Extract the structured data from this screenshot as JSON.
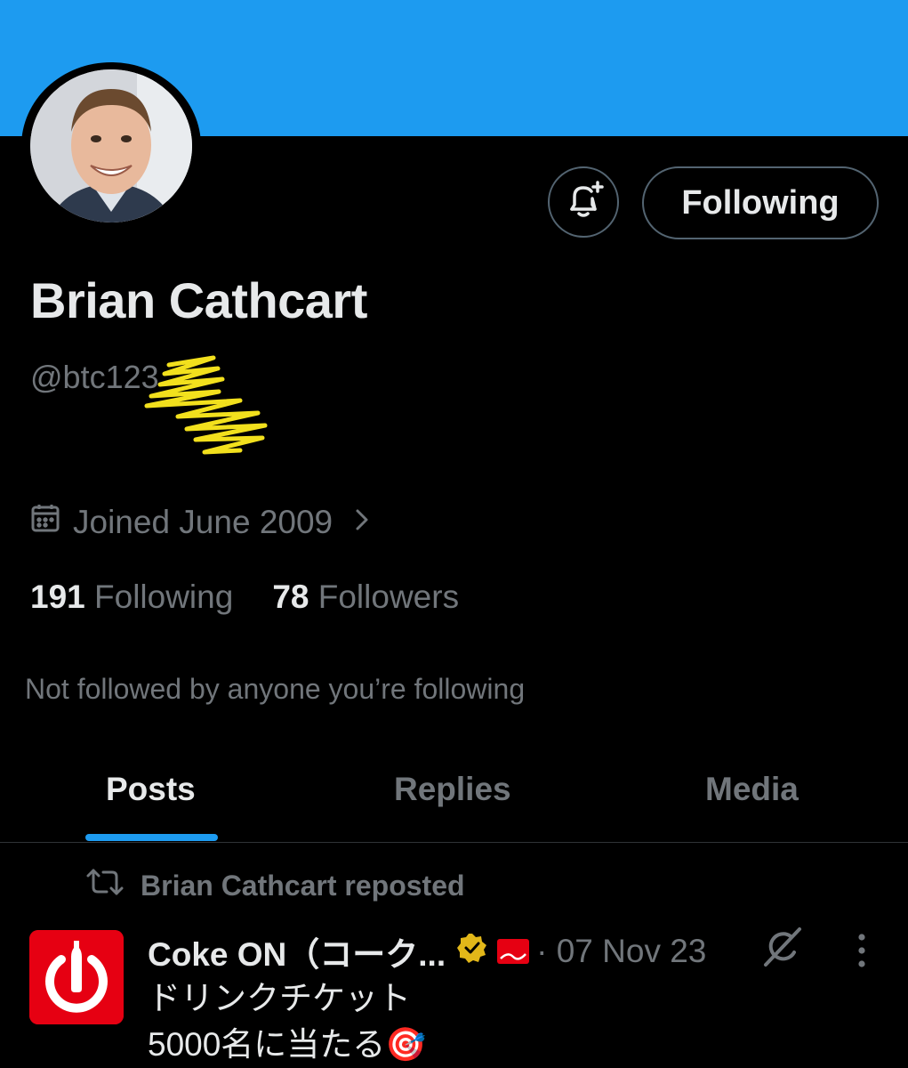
{
  "colors": {
    "accent": "#1d9bf0",
    "background": "#000000",
    "secondary_text": "#71767b",
    "primary_text": "#e7e9ea",
    "brand_red": "#e60012"
  },
  "profile": {
    "name": "Brian Cathcart",
    "handle": "@btc123",
    "joined": "Joined June 2009",
    "following_count": "191",
    "following_label": "Following",
    "followers_count": "78",
    "followers_label": "Followers",
    "not_followed_text": "Not followed by anyone you’re following"
  },
  "actions": {
    "notify_icon": "bell-plus-icon",
    "follow_state_label": "Following"
  },
  "tabs": [
    {
      "label": "Posts",
      "active": true
    },
    {
      "label": "Replies",
      "active": false
    },
    {
      "label": "Media",
      "active": false
    }
  ],
  "post": {
    "repost_label": "Brian Cathcart reposted",
    "author_name": "Coke ON（コーク...",
    "date": "· 07 Nov 23",
    "lines": [
      "ドリンクチケット",
      "5000名に当たる🎯"
    ]
  }
}
